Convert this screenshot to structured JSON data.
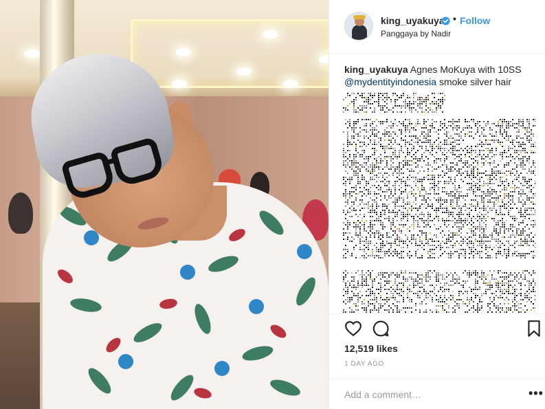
{
  "post": {
    "username": "king_uyakuya",
    "follow_label": "Follow",
    "separator": "•",
    "location": "Panggaya by Nadir",
    "caption": {
      "username": "king_uyakuya",
      "text_before": " Agnes MoKuya with 10SS ",
      "mention": "@mydentityindonesia",
      "text_after": " smoke silver hair"
    },
    "likes": "12,519 likes",
    "time_ago": "1 DAY AGO",
    "comment_placeholder": "Add a comment…",
    "more_label": "•••"
  },
  "icons": {
    "like": "heart-outline-icon",
    "comment": "speech-bubble-icon",
    "save": "bookmark-outline-icon",
    "verified": "verified-badge-icon"
  },
  "colors": {
    "link_blue": "#3897f0",
    "mention_blue": "#003569",
    "verified_blue": "#3897f0",
    "muted": "#999999"
  }
}
